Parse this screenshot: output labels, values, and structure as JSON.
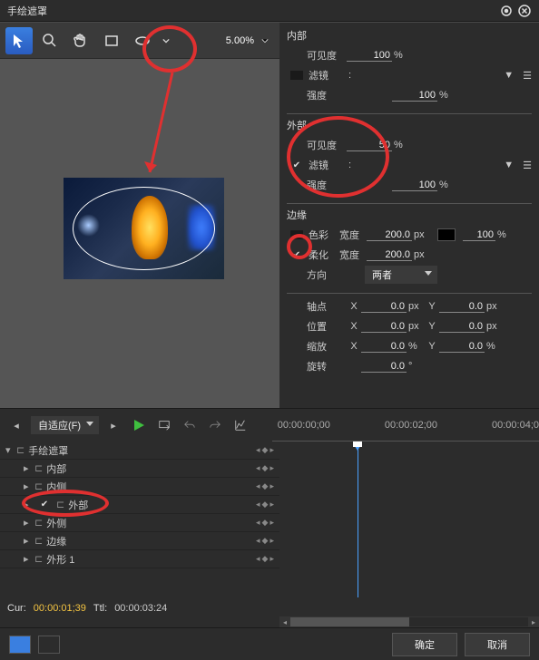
{
  "title": "手绘遮罩",
  "toolbar": {
    "zoom": "5.00%"
  },
  "props": {
    "inner": {
      "head": "内部",
      "visibility_lbl": "可见度",
      "visibility": "100",
      "visibility_u": "%",
      "filter_lbl": "滤镜",
      "filter_sep": ":",
      "strength_lbl": "强度",
      "strength": "100",
      "strength_u": "%"
    },
    "outer": {
      "head": "外部",
      "visibility_lbl": "可见度",
      "visibility": "50",
      "visibility_u": "%",
      "filter_lbl": "滤镜",
      "filter_sep": ":",
      "strength_lbl": "强度",
      "strength": "100",
      "strength_u": "%"
    },
    "edge": {
      "head": "边缘",
      "color_lbl": "色彩",
      "width_lbl": "宽度",
      "cw": "200.0",
      "cw_u": "px",
      "cpct": "100",
      "cpct_u": "%",
      "soft_lbl": "柔化",
      "sw": "200.0",
      "sw_u": "px",
      "dir_lbl": "方向",
      "dir_val": "两者"
    },
    "xf": {
      "pivot_lbl": "轴点",
      "pos_lbl": "位置",
      "scale_lbl": "缩放",
      "rot_lbl": "旋转",
      "x": "X",
      "y": "Y",
      "pvx": "0.0",
      "pvy": "0.0",
      "px_u": "px",
      "psx": "0.0",
      "psy": "0.0",
      "scx": "0.0",
      "scy": "0.0",
      "pct": "%",
      "rot": "0.0",
      "deg": "°"
    }
  },
  "timeline": {
    "fit": "自适应(F)",
    "t0": "00:00:00;00",
    "t2": "00:00:02;00",
    "t4": "00:00:04;0",
    "tracks": [
      "手绘遮罩",
      "内部",
      "内侧",
      "外部",
      "外侧",
      "边缘",
      "外形 1"
    ],
    "cur_l": "Cur:",
    "cur": "00:00:01;39",
    "ttl_l": "Ttl:",
    "ttl": "00:00:03:24"
  },
  "buttons": {
    "ok": "确定",
    "cancel": "取消"
  }
}
